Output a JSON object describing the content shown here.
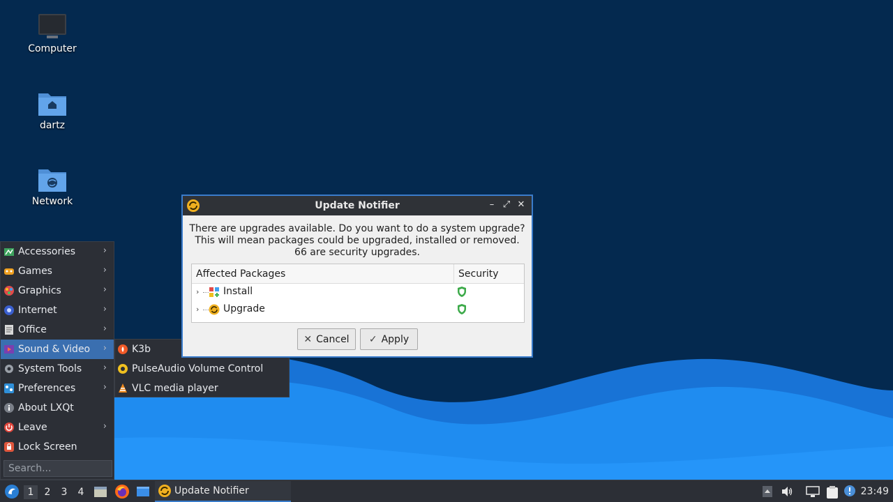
{
  "desktop": {
    "icons": [
      {
        "label": "Computer"
      },
      {
        "label": "dartz"
      },
      {
        "label": "Network"
      }
    ]
  },
  "menu": {
    "items": [
      {
        "label": "Accessories",
        "icon": "accessories-icon",
        "has_submenu": true
      },
      {
        "label": "Games",
        "icon": "games-icon",
        "has_submenu": true
      },
      {
        "label": "Graphics",
        "icon": "graphics-icon",
        "has_submenu": true
      },
      {
        "label": "Internet",
        "icon": "internet-icon",
        "has_submenu": true
      },
      {
        "label": "Office",
        "icon": "office-icon",
        "has_submenu": true
      },
      {
        "label": "Sound & Video",
        "icon": "sound-video-icon",
        "has_submenu": true,
        "active": true
      },
      {
        "label": "System Tools",
        "icon": "system-tools-icon",
        "has_submenu": true
      },
      {
        "label": "Preferences",
        "icon": "preferences-icon",
        "has_submenu": true
      },
      {
        "label": "About LXQt",
        "icon": "info-icon",
        "has_submenu": false
      },
      {
        "label": "Leave",
        "icon": "power-icon",
        "has_submenu": true
      },
      {
        "label": "Lock Screen",
        "icon": "lock-icon",
        "has_submenu": false
      }
    ],
    "search_placeholder": "Search..."
  },
  "submenu": {
    "items": [
      {
        "label": "K3b",
        "icon": "k3b-icon"
      },
      {
        "label": "PulseAudio Volume Control",
        "icon": "pulseaudio-icon"
      },
      {
        "label": "VLC media player",
        "icon": "vlc-icon"
      }
    ]
  },
  "dialog": {
    "title": "Update Notifier",
    "message_line1": "There are upgrades available. Do you want to do a system upgrade?",
    "message_line2": "This will mean packages could be upgraded, installed or removed.",
    "message_line3": "66 are security upgrades.",
    "table": {
      "col_packages": "Affected Packages",
      "col_security": "Security",
      "rows": [
        {
          "label": "Install",
          "icon": "install-icon",
          "security": "shield-icon"
        },
        {
          "label": "Upgrade",
          "icon": "upgrade-icon",
          "security": "shield-icon"
        }
      ]
    },
    "cancel_label": "Cancel",
    "apply_label": "Apply"
  },
  "taskbar": {
    "workspaces": [
      "1",
      "2",
      "3",
      "4"
    ],
    "active_workspace": "1",
    "task_label": "Update Notifier",
    "clock": "23:49"
  },
  "colors": {
    "desktop_bg": "#04294f",
    "wave_light": "#1e8ff0",
    "accent": "#3a7ccb",
    "panel": "#2c2f36"
  }
}
